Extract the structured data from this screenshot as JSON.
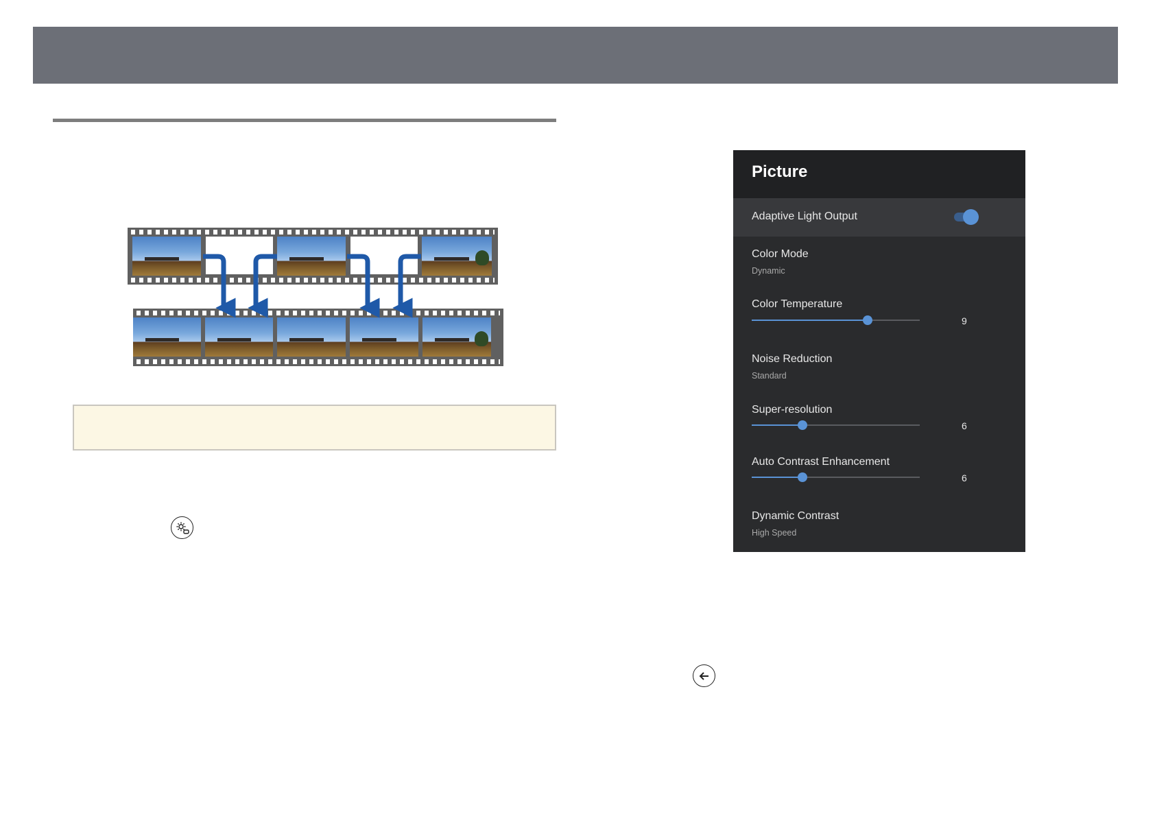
{
  "panel": {
    "title": "Picture",
    "items": [
      {
        "label": "Adaptive Light Output",
        "toggle_on": true
      },
      {
        "label": "Color Mode",
        "value": "Dynamic"
      },
      {
        "label": "Color Temperature",
        "value": "9",
        "level": 0.69
      },
      {
        "label": "Noise Reduction",
        "value": "Standard"
      },
      {
        "label": "Super-resolution",
        "value": "6",
        "level": 0.3
      },
      {
        "label": "Auto Contrast Enhancement",
        "value": "6",
        "level": 0.3
      },
      {
        "label": "Dynamic Contrast",
        "value": "High Speed"
      }
    ]
  },
  "icons": {
    "settings": "settings-remote-icon",
    "back": "back-arrow-icon",
    "arrow": "frame-interpolation-arrow-icon"
  },
  "colors": {
    "header_bar": "#6c6f77",
    "panel_bg": "#2a2b2d",
    "accent": "#5a93d6",
    "arrow": "#1f59a8",
    "note_bg": "#fcf7e4"
  }
}
